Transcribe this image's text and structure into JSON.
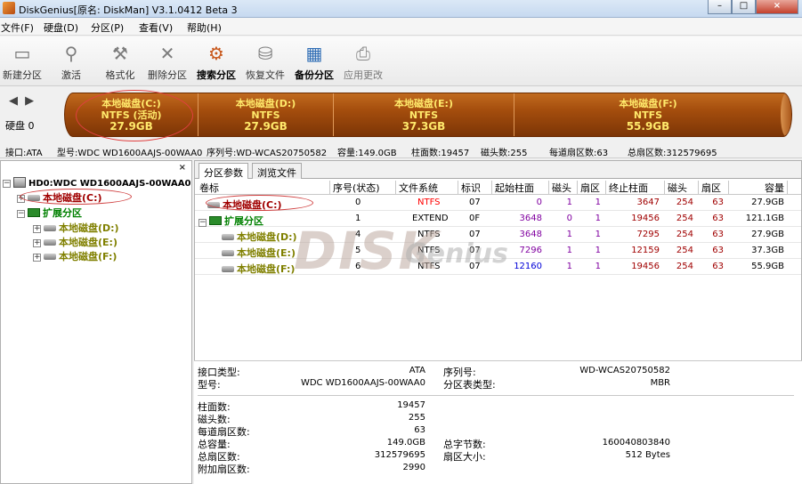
{
  "app": {
    "title": "DiskGenius[原名: DiskMan] V3.1.0412 Beta 3"
  },
  "window_buttons": {
    "minimize": "–",
    "maximize": "□",
    "close": "×"
  },
  "menu": [
    "文件(F)",
    "硬盘(D)",
    "分区(P)",
    "查看(V)",
    "帮助(H)"
  ],
  "toolbar": [
    {
      "label": "新建分区",
      "icon": "new-partition-icon",
      "state": "normal"
    },
    {
      "label": "激活",
      "icon": "activate-icon",
      "state": "normal"
    },
    {
      "label": "格式化",
      "icon": "format-icon",
      "state": "normal"
    },
    {
      "label": "删除分区",
      "icon": "delete-icon",
      "state": "normal"
    },
    {
      "label": "搜索分区",
      "icon": "search-partition-icon",
      "state": "bold"
    },
    {
      "label": "恢复文件",
      "icon": "recover-files-icon",
      "state": "normal"
    },
    {
      "label": "备份分区",
      "icon": "backup-icon",
      "state": "bold"
    },
    {
      "label": "应用更改",
      "icon": "apply-icon",
      "state": "disabled"
    }
  ],
  "disk_nav": {
    "label": "硬盘 0",
    "arrows": "◀ ▶"
  },
  "partitions_bar": [
    {
      "name": "本地磁盘(C:)",
      "fs": "NTFS (活动)",
      "size": "27.9GB"
    },
    {
      "name": "本地磁盘(D:)",
      "fs": "NTFS",
      "size": "27.9GB"
    },
    {
      "name": "本地磁盘(E:)",
      "fs": "NTFS",
      "size": "37.3GB"
    },
    {
      "name": "本地磁盘(F:)",
      "fs": "NTFS",
      "size": "55.9GB"
    }
  ],
  "info_bar": [
    "接口:ATA",
    "型号:WDC WD1600AAJS-00WAA0",
    "序列号:WD-WCAS20750582",
    "容量:149.0GB",
    "柱面数:19457",
    "磁头数:255",
    "每道扇区数:63",
    "总扇区数:312579695"
  ],
  "tree": {
    "close": "×",
    "disk": "HD0:WDC WD1600AAJS-00WAA0",
    "items": [
      {
        "label": "本地磁盘(C:)",
        "level": 1,
        "type": "drive",
        "color": "#a00000"
      },
      {
        "label": "扩展分区",
        "level": 1,
        "type": "extended",
        "color": "#008000"
      },
      {
        "label": "本地磁盘(D:)",
        "level": 2,
        "type": "drive",
        "color": "#808000"
      },
      {
        "label": "本地磁盘(E:)",
        "level": 2,
        "type": "drive",
        "color": "#808000"
      },
      {
        "label": "本地磁盘(F:)",
        "level": 2,
        "type": "drive",
        "color": "#808000"
      }
    ]
  },
  "tabs": [
    {
      "label": "分区参数",
      "active": true
    },
    {
      "label": "浏览文件",
      "active": false
    }
  ],
  "grid": {
    "headers": [
      "卷标",
      "序号(状态)",
      "文件系统",
      "标识",
      "起始柱面",
      "磁头",
      "扇区",
      "终止柱面",
      "磁头",
      "扇区",
      "容量"
    ],
    "rows": [
      {
        "name": "本地磁盘(C:)",
        "num": "0",
        "fs": "NTFS",
        "id": "07",
        "sc": "0",
        "sh": "1",
        "ss": "1",
        "ec": "3647",
        "eh": "254",
        "es": "63",
        "cap": "27.9GB",
        "kind": "c"
      },
      {
        "name": "扩展分区",
        "num": "1",
        "fs": "EXTEND",
        "id": "0F",
        "sc": "3648",
        "sh": "0",
        "ss": "1",
        "ec": "19456",
        "eh": "254",
        "es": "63",
        "cap": "121.1GB",
        "kind": "ext"
      },
      {
        "name": "本地磁盘(D:)",
        "num": "4",
        "fs": "NTFS",
        "id": "07",
        "sc": "3648",
        "sh": "1",
        "ss": "1",
        "ec": "7295",
        "eh": "254",
        "es": "63",
        "cap": "27.9GB",
        "kind": "log"
      },
      {
        "name": "本地磁盘(E:)",
        "num": "5",
        "fs": "NTFS",
        "id": "07",
        "sc": "7296",
        "sh": "1",
        "ss": "1",
        "ec": "12159",
        "eh": "254",
        "es": "63",
        "cap": "37.3GB",
        "kind": "log"
      },
      {
        "name": "本地磁盘(F:)",
        "num": "6",
        "fs": "NTFS",
        "id": "07",
        "sc": "12160",
        "sh": "1",
        "ss": "1",
        "ec": "19456",
        "eh": "254",
        "es": "63",
        "cap": "55.9GB",
        "kind": "log"
      }
    ]
  },
  "watermark": {
    "main": "DISK",
    "sub": "Genius"
  },
  "details": {
    "left_top": [
      {
        "label": "接口类型:",
        "value": "ATA"
      },
      {
        "label": "型号:",
        "value": "WDC WD1600AAJS-00WAA0"
      }
    ],
    "right_top": [
      {
        "label": "序列号:",
        "value": "WD-WCAS20750582"
      },
      {
        "label": "分区表类型:",
        "value": "MBR"
      }
    ],
    "left_bottom": [
      {
        "label": "柱面数:",
        "value": "19457"
      },
      {
        "label": "磁头数:",
        "value": "255"
      },
      {
        "label": "每道扇区数:",
        "value": "63"
      },
      {
        "label": "总容量:",
        "value": "149.0GB"
      },
      {
        "label": "总扇区数:",
        "value": "312579695"
      },
      {
        "label": "附加扇区数:",
        "value": "2990"
      }
    ],
    "right_bottom": [
      {
        "label": "总字节数:",
        "value": "160040803840"
      },
      {
        "label": "扇区大小:",
        "value": "512 Bytes"
      }
    ]
  }
}
